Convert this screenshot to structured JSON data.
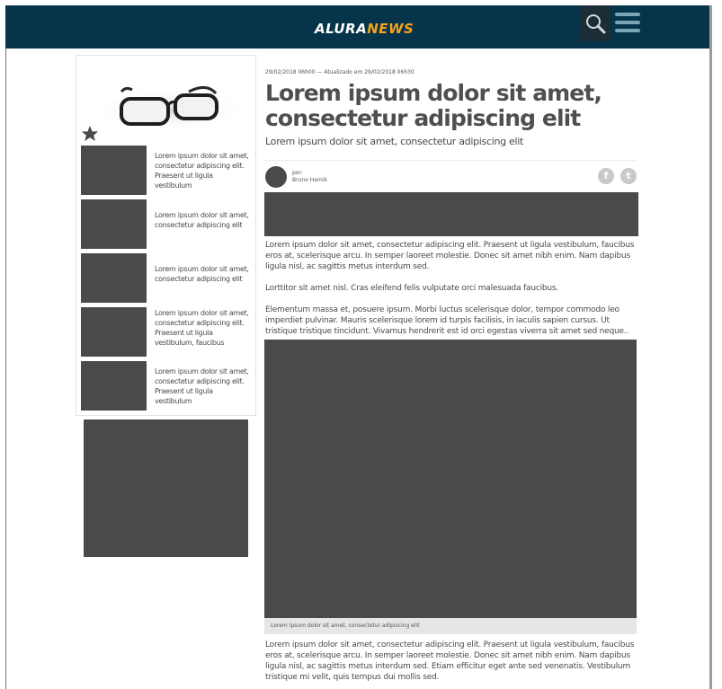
{
  "header": {
    "logo_part1": "ALURA",
    "logo_part2": "NEWS",
    "search_icon": "search-icon",
    "menu_icon": "hamburger-menu-icon"
  },
  "colors": {
    "header_bg": "#06344b",
    "logo_accent": "#f7a21b",
    "placeholder": "#4a4a4a",
    "menu_icon": "#7aa3b3"
  },
  "sidebar": {
    "star_icon": "star-icon",
    "image_icon": "eyeglasses-image",
    "items": [
      {
        "text": "Lorem ipsum dolor sit amet, consectetur adipiscing elit. Praesent ut ligula vestibulum"
      },
      {
        "text": "Lorem ipsum dolor sit amet, consectetur adipiscing elit"
      },
      {
        "text": "Lorem ipsum dolor sit amet, consectetur adipiscing elit"
      },
      {
        "text": "Lorem ipsum dolor sit amet, consectetur adipiscing elit. Praesent ut ligula vestibulum, faucibus"
      },
      {
        "text": "Lorem ipsum dolor sit amet, consectetur adipiscing elit. Praesent ut ligula vestibulum"
      }
    ]
  },
  "article": {
    "meta": "29/02/2018 06h00 — Atualizado em 29/02/2018 06h30",
    "title": "Lorem ipsum dolor sit amet, consectetur adipiscing elit",
    "subtitle": "Lorem ipsum dolor sit amet, consectetur adipiscing elit",
    "author_prefix": "por:",
    "author_name": "Bruno Hamik",
    "share_facebook": "f",
    "share_twitter": "t",
    "paragraphs": [
      "Lorem ipsum dolor sit amet, consectetur adipiscing elit. Praesent ut ligula vestibulum, faucibus eros at, scelerisque arcu. In semper laoreet molestie. Donec sit amet nibh enim. Nam dapibus ligula nisl, ac sagittis metus interdum sed.",
      "Lorttitor sit amet nisl. Cras eleifend felis vulputate orci malesuada faucibus.",
      "Elementum massa et, posuere ipsum. Morbi luctus scelerisque dolor, tempor commodo leo imperdiet pulvinar. Mauris scelerisque lorem id turpis facilisis, in iaculis sapien cursus. Ut tristique tristique tincidunt. Vivamus hendrerit est id orci egestas viverra sit amet sed neque..",
      "Lorem ipsum dolor sit amet, consectetur adipiscing elit. Praesent ut ligula vestibulum, faucibus eros at, scelerisque arcu. In semper laoreet molestie. Donec sit amet nibh enim. Nam dapibus ligula nisl, ac sagittis metus interdum sed. Etiam efficitur eget ante sed venenatis. Vestibulum tristique mi velit, quis tempus dui mollis sed."
    ],
    "image_caption": "Lorem ipsum dolor sit amet, consectetur adipiscing elit"
  }
}
